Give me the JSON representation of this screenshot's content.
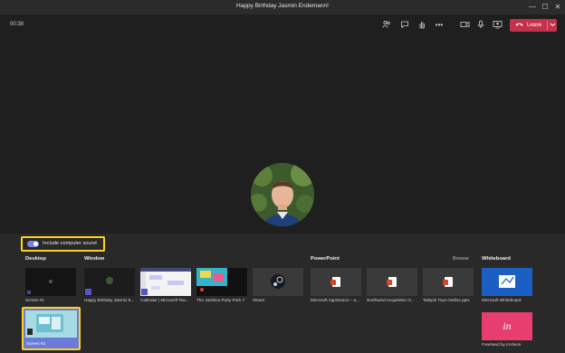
{
  "window": {
    "title": "Happy Birthday Jasmin Endemann!",
    "controls": {
      "minimize": "—",
      "maximize": "☐",
      "close": "✕"
    }
  },
  "toolbar": {
    "timer": "00:38",
    "icons": [
      "people-icon",
      "chat-icon",
      "raise-hand-icon",
      "more-icon",
      "camera-icon",
      "mic-icon",
      "share-icon"
    ],
    "more_glyph": "•••",
    "leave_label": "Leave"
  },
  "share": {
    "include_sound_label": "Include computer sound",
    "include_sound_on": true,
    "sections": {
      "desktop": "Desktop",
      "window": "Window",
      "powerpoint": "PowerPoint",
      "browse": "Browse",
      "whiteboard": "Whiteboard"
    },
    "desktop_items": [
      {
        "caption": "Screen #1"
      },
      {
        "caption": "Screen #2"
      }
    ],
    "window_items": [
      {
        "caption": "Happy Birthday Jasmin E..."
      },
      {
        "caption": "Calendar | Microsoft Tea..."
      },
      {
        "caption": "The Jackbox Party Pack 7"
      },
      {
        "caption": "Steam"
      }
    ],
    "ppt_items": [
      {
        "caption": "Microsoft AppSource – a..."
      },
      {
        "caption": "Northwind Acquisition O..."
      },
      {
        "caption": "Tailspin Toys Outline.pptx"
      }
    ],
    "whiteboard_items": [
      {
        "caption": "Microsoft Whiteboard"
      },
      {
        "caption": "Freehand by InVision",
        "logo": "in"
      }
    ]
  },
  "colors": {
    "accent": "#7b83eb",
    "leave": "#c4314b",
    "highlight": "#ffd21f"
  }
}
